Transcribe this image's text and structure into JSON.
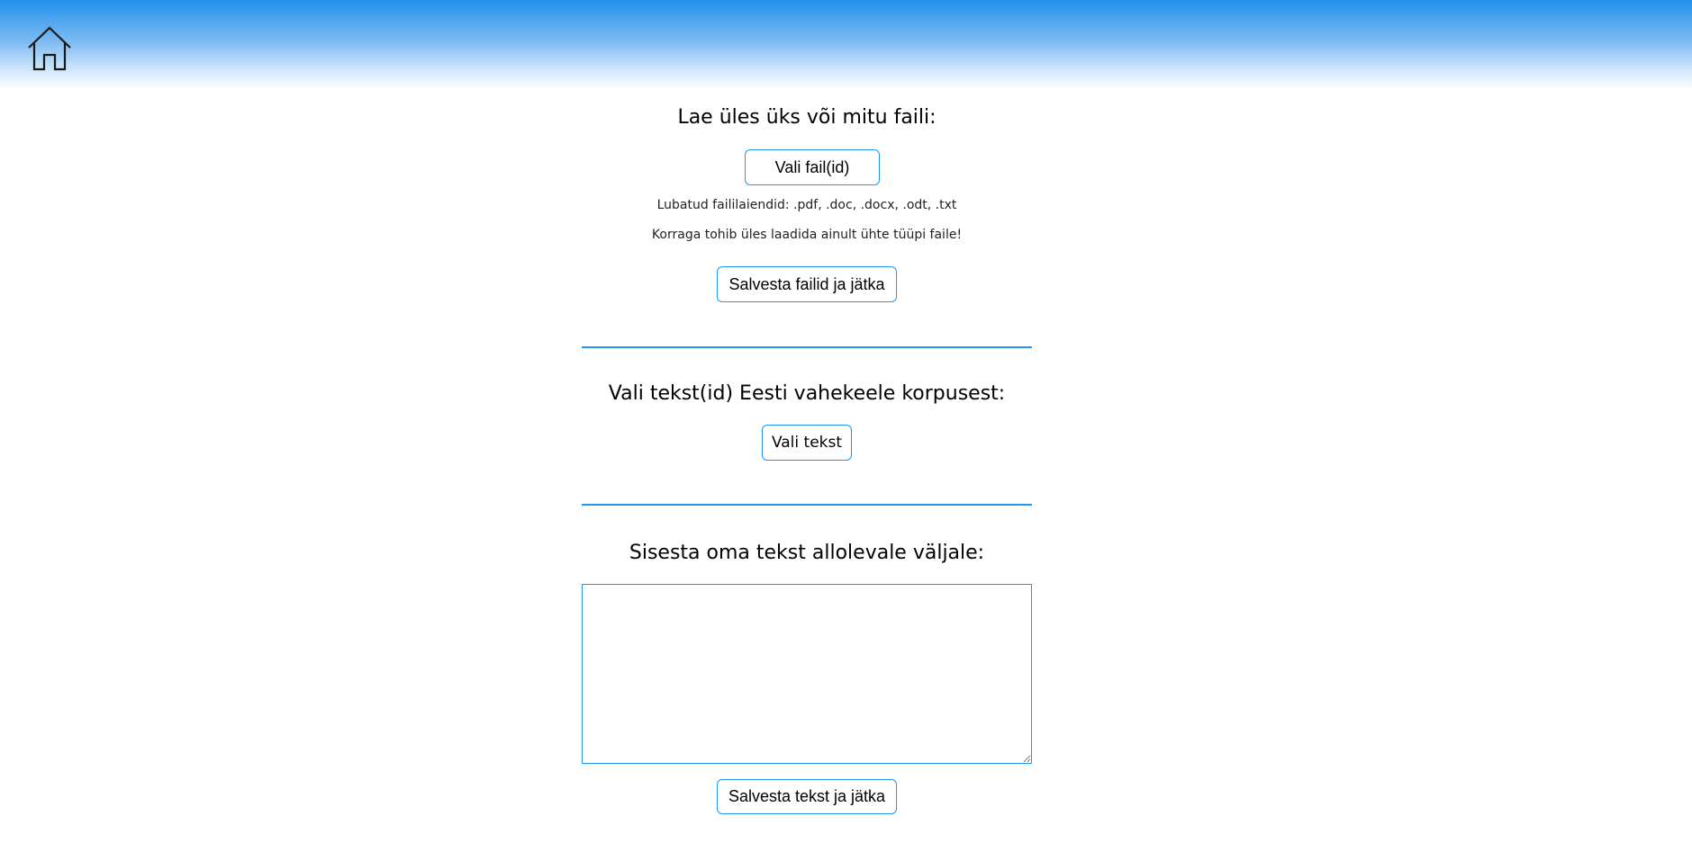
{
  "header": {
    "home_icon": "home-icon"
  },
  "upload_section": {
    "heading": "Lae üles üks või mitu faili:",
    "choose_files_label": "Vali fail(id)",
    "allowed_extensions": "Lubatud faililaiendid: .pdf, .doc, .docx, .odt, .txt",
    "single_type_note": "Korraga tohib üles laadida ainult ühte tüüpi faile!",
    "save_files_label": "Salvesta failid ja jätka"
  },
  "corpus_section": {
    "heading": "Vali tekst(id) Eesti vahekeele korpusest:",
    "choose_text_label": "Vali tekst"
  },
  "text_section": {
    "heading": "Sisesta oma tekst allolevale väljale:",
    "textarea_value": "",
    "save_text_label": "Salvesta tekst ja jätka"
  },
  "colors": {
    "accent": "#2196f3",
    "header_top": "#2490ea"
  }
}
